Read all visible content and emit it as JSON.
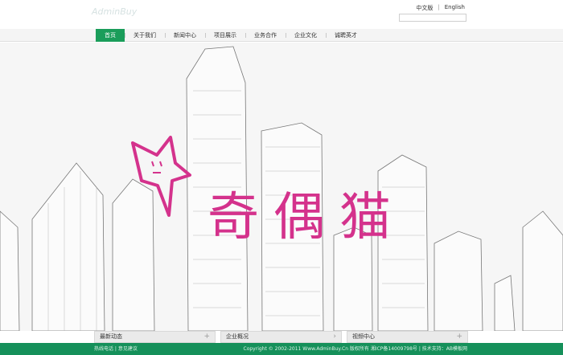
{
  "header": {
    "logo_text": "AdminBuy",
    "lang_cn": "中文版",
    "lang_sep": "|",
    "lang_en": "English",
    "search_placeholder": ""
  },
  "nav": {
    "items": [
      {
        "label": "首页",
        "active": true
      },
      {
        "label": "关于我们"
      },
      {
        "label": "新闻中心"
      },
      {
        "label": "项目展示"
      },
      {
        "label": "业务合作"
      },
      {
        "label": "企业文化"
      },
      {
        "label": "诚聘英才"
      }
    ]
  },
  "hero": {
    "title": "奇偶猫",
    "accent_color": "#d4328c"
  },
  "panels": [
    {
      "label": "最新动态",
      "icon": "plus-icon"
    },
    {
      "label": "企业概况",
      "icon": "plus-icon"
    },
    {
      "label": "视频中心",
      "icon": "plus-icon"
    }
  ],
  "footer": {
    "left_text": "热线电话 | 意见建议",
    "right_text": "Copyright © 2002-2011 Www.AdminBuy.Cn 版权所有 湘ICP备14009798号 | 技术支持：AB模板网"
  },
  "colors": {
    "brand_green": "#15905a",
    "nav_active": "#1a9d5a"
  }
}
